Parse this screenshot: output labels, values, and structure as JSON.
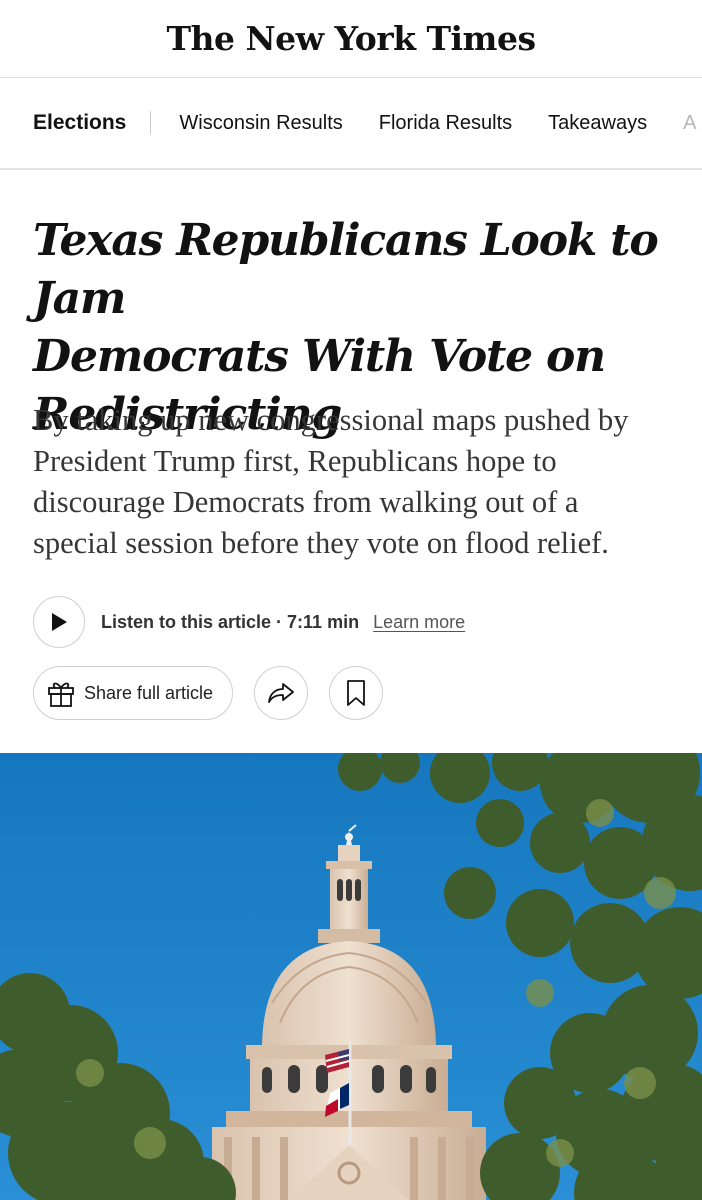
{
  "masthead": {
    "logo_text": "The New York Times"
  },
  "subnav": {
    "section": "Elections",
    "links": [
      "Wisconsin Results",
      "Florida Results",
      "Takeaways",
      "A"
    ]
  },
  "article": {
    "headline_lines": [
      "Texas Republicans Look to Jam",
      "Democrats With Vote on",
      "Redistricting"
    ],
    "summary_lines": [
      "By taking up new congressional maps pushed by",
      "President Trump first, Republicans hope to",
      "discourage Democrats from walking out of a",
      "special session before they vote on flood relief."
    ]
  },
  "audio": {
    "listen_label": "Listen to this article · 7:11 min",
    "learn_more": "Learn more"
  },
  "actions": {
    "share_label": "Share full article",
    "icons": [
      "gift-icon",
      "share-arrow-icon",
      "bookmark-icon"
    ]
  },
  "photo": {
    "subject": "Texas State Capitol dome with flags against a blue sky, framed by tree branches",
    "colors": {
      "sky": "#1a7fc4",
      "dome": "#e9d7c4",
      "foliage": "#3e5b2e"
    }
  }
}
